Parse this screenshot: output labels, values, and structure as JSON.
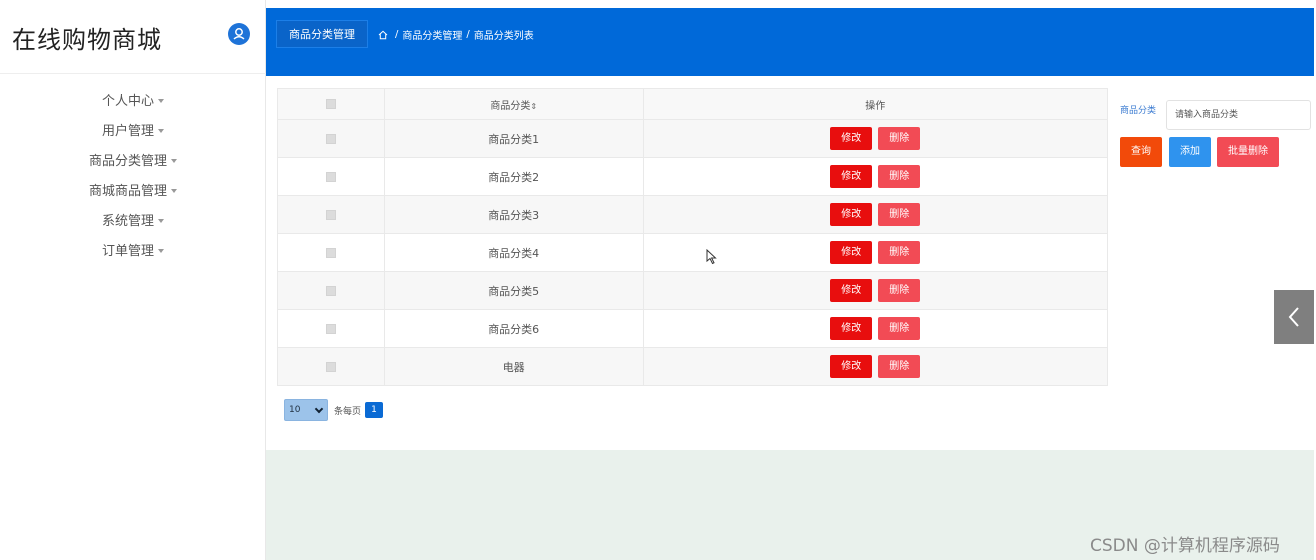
{
  "brand": {
    "title": "在线购物商城"
  },
  "sidebar": {
    "items": [
      {
        "label": "个人中心"
      },
      {
        "label": "用户管理"
      },
      {
        "label": "商品分类管理"
      },
      {
        "label": "商城商品管理"
      },
      {
        "label": "系统管理"
      },
      {
        "label": "订单管理"
      }
    ]
  },
  "header": {
    "active_tab": "商品分类管理",
    "breadcrumb": [
      "商品分类管理",
      "商品分类列表"
    ],
    "breadcrumb_separator": "/"
  },
  "table": {
    "columns": [
      "商品分类",
      "操作"
    ],
    "sort_indicator": "⇕",
    "edit_label": "修改",
    "delete_label": "删除",
    "rows": [
      {
        "name": "商品分类1"
      },
      {
        "name": "商品分类2"
      },
      {
        "name": "商品分类3"
      },
      {
        "name": "商品分类4"
      },
      {
        "name": "商品分类5"
      },
      {
        "name": "商品分类6"
      },
      {
        "name": "电器"
      }
    ]
  },
  "pagination": {
    "page_size": "10",
    "per_page_label": "条每页",
    "current_page": "1"
  },
  "search": {
    "label": "商品分类",
    "placeholder": "请输入商品分类",
    "query_label": "查询",
    "add_label": "添加",
    "batch_delete_label": "批量删除"
  },
  "watermark": "CSDN @计算机程序源码",
  "colors": {
    "header_bg": "#0069d9",
    "edit_button": "#e80e0e",
    "delete_button": "#f24b55",
    "query_button": "#f24a0a",
    "add_button": "#2f93ee",
    "footer_bg": "#e9f1ec"
  },
  "icons": {
    "avatar": "user-icon",
    "home": "home-icon",
    "side_toggle": "chevron-left-icon"
  }
}
